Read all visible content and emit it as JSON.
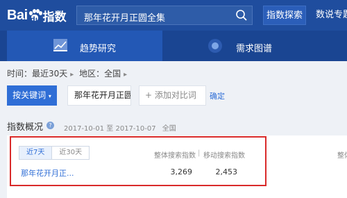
{
  "header": {
    "logo_text": "Bai",
    "logo_du": "du",
    "logo_suffix": "指数",
    "search_value": "那年花开月正圆全集",
    "explore_button": "指数探索",
    "more_nav": "数说专题"
  },
  "tabs": [
    {
      "label": "趋势研究"
    },
    {
      "label": "需求图谱"
    }
  ],
  "filters": {
    "time_label": "时间：最近30天",
    "region_label": "地区：全国"
  },
  "controls": {
    "keyword_button": "按关键词",
    "keyword_value": "那年花开月正圆",
    "add_compare": "+ 添加对比词",
    "confirm": "确定"
  },
  "overview": {
    "title": "指数概况",
    "help": "?",
    "date_range": "2017-10-01 至 2017-10-07",
    "region": "全国",
    "period_tabs": [
      "近7天",
      "近30天"
    ],
    "col_overall": "整体搜索指数",
    "col_separator": "|",
    "col_mobile": "移动搜索指数",
    "col_overall_right": "整体",
    "rows": [
      {
        "name": "那年花开月正...",
        "overall": "3,269",
        "mobile": "2,453"
      }
    ]
  }
}
